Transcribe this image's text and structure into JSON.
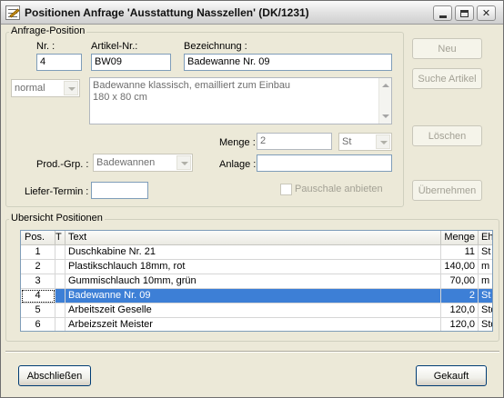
{
  "window": {
    "title": "Positionen Anfrage 'Ausstattung Nasszellen' (DK/1231)",
    "controls": [
      "minimize-icon",
      "maximize-icon",
      "close-icon"
    ],
    "close_glyph": "✕"
  },
  "form": {
    "group_title": "Anfrage-Position",
    "nr_label": "Nr. :",
    "nr_value": "4",
    "artikel_label": "Artikel-Nr.:",
    "artikel_value": "BW09",
    "bezeichnung_label": "Bezeichnung :",
    "bezeichnung_value": "Badewanne Nr. 09",
    "type_select_value": "normal",
    "description_line1": "Badewanne klassisch, emailliert zum Einbau",
    "description_line2": "180 x 80 cm",
    "menge_label": "Menge :",
    "menge_value": "2",
    "unit_select_value": "St",
    "prod_grp_label": "Prod.-Grp. :",
    "prod_grp_value": "Badewannen",
    "anlage_label": "Anlage :",
    "anlage_value": "",
    "liefer_termin_label": "Liefer-Termin :",
    "liefer_termin_value": "",
    "pauschale_label": "Pauschale anbieten"
  },
  "side_buttons": {
    "neu": "Neu",
    "suche_artikel": "Suche Artikel",
    "loeschen": "Löschen",
    "uebernehmen": "Übernehmen"
  },
  "table": {
    "group_title": "Ubersicht Positionen",
    "headers": {
      "pos": "Pos.",
      "t": "T",
      "text": "Text",
      "menge": "Menge",
      "eh": "Eh."
    },
    "rows": [
      {
        "pos": "1",
        "t": "",
        "text": "Duschkabine Nr. 21",
        "menge": "11",
        "eh": "St"
      },
      {
        "pos": "2",
        "t": "",
        "text": "Plastikschlauch 18mm, rot",
        "menge": "140,00",
        "eh": "m"
      },
      {
        "pos": "3",
        "t": "",
        "text": "Gummischlauch 10mm, grün",
        "menge": "70,00",
        "eh": "m"
      },
      {
        "pos": "4",
        "t": "",
        "text": "Badewanne Nr. 09",
        "menge": "2",
        "eh": "St"
      },
      {
        "pos": "5",
        "t": "",
        "text": "Arbeitszeit Geselle",
        "menge": "120,0",
        "eh": "Std"
      },
      {
        "pos": "6",
        "t": "",
        "text": "Arbeizszeit Meister",
        "menge": "120,0",
        "eh": "Std"
      }
    ],
    "selected_index": 3
  },
  "footer": {
    "abschliessen": "Abschließen",
    "gekauft": "Gekauft"
  },
  "colors": {
    "selection": "#3d7fd6",
    "window_bg": "#ECE9D8",
    "button_border": "#003c74"
  }
}
